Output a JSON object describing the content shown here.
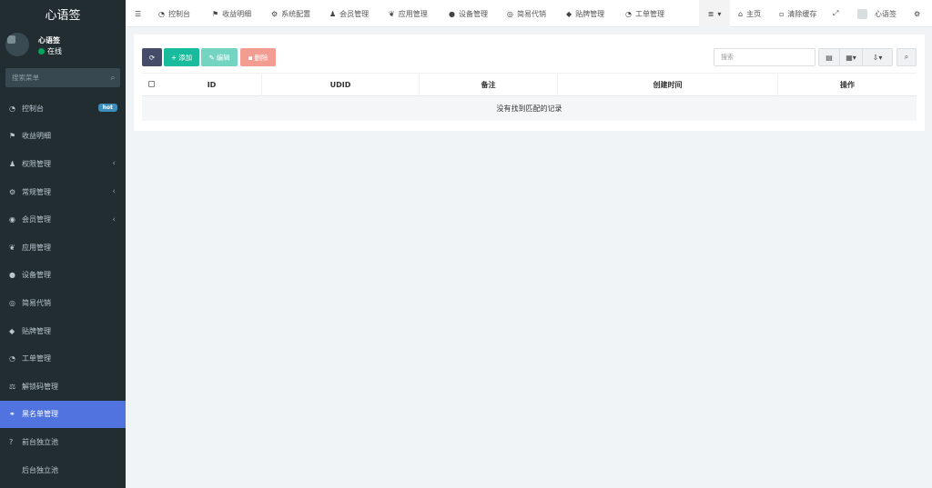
{
  "brand": {
    "title": "心语签"
  },
  "user": {
    "name": "心语签",
    "status": "在线"
  },
  "sidebar": {
    "search_placeholder": "搜索菜单",
    "items": [
      {
        "label": "控制台",
        "icon": "dashboard-icon",
        "badge": "hot"
      },
      {
        "label": "收益明细",
        "icon": "flag-icon"
      },
      {
        "label": "权限管理",
        "icon": "users-icon",
        "expandable": true
      },
      {
        "label": "常规管理",
        "icon": "cogs-icon",
        "expandable": true
      },
      {
        "label": "会员管理",
        "icon": "user-circle-icon",
        "expandable": true
      },
      {
        "label": "应用管理",
        "icon": "leaf-icon"
      },
      {
        "label": "设备管理",
        "icon": "circle-icon"
      },
      {
        "label": "简易代销",
        "icon": "spotify-icon"
      },
      {
        "label": "贴牌管理",
        "icon": "tags-icon"
      },
      {
        "label": "工单管理",
        "icon": "dashboard-icon"
      },
      {
        "label": "解锁码管理",
        "icon": "balance-scale-icon"
      },
      {
        "label": "黑名单管理",
        "icon": "bicycle-icon",
        "active": true
      },
      {
        "label": "前台独立池",
        "icon": "question-circle-icon"
      },
      {
        "label": "后台独立池",
        "icon": "apple-icon"
      }
    ]
  },
  "topnav": {
    "menu_toggle": "☰",
    "tabs": [
      {
        "label": "控制台",
        "icon": "dashboard-icon"
      },
      {
        "label": "收益明细",
        "icon": "flag-icon"
      },
      {
        "label": "系统配置",
        "icon": "cog-icon"
      },
      {
        "label": "会员管理",
        "icon": "users-icon"
      },
      {
        "label": "应用管理",
        "icon": "leaf-icon"
      },
      {
        "label": "设备管理",
        "icon": "circle-icon"
      },
      {
        "label": "简易代销",
        "icon": "spotify-icon"
      },
      {
        "label": "贴牌管理",
        "icon": "tags-icon"
      },
      {
        "label": "工单管理",
        "icon": "dashboard-icon"
      }
    ],
    "home": "主页",
    "clear_cache": "清除缓存",
    "account_name": "心语签"
  },
  "toolbar": {
    "add": "添加",
    "edit": "编辑",
    "delete": "删除",
    "search_placeholder": "搜索"
  },
  "table": {
    "columns": [
      "ID",
      "UDID",
      "备注",
      "创建时间",
      "操作"
    ],
    "empty_message": "没有找到匹配的记录"
  },
  "colors": {
    "sidebar_bg": "#222d32",
    "active_item": "#5173e0",
    "primary_green": "#18bc9c",
    "danger": "#f39c92",
    "dark_button": "#444c69"
  }
}
